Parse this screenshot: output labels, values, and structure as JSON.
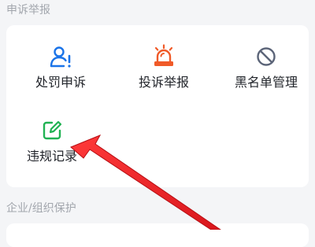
{
  "sections": [
    {
      "title": "申诉举报",
      "items": [
        {
          "label": "处罚申诉",
          "icon": "user-alert-icon",
          "color": "#1a73e8"
        },
        {
          "label": "投诉举报",
          "icon": "siren-icon",
          "color": "#f05a28"
        },
        {
          "label": "黑名单管理",
          "icon": "ban-icon",
          "color": "#5b6478"
        },
        {
          "label": "违规记录",
          "icon": "edit-note-icon",
          "color": "#21b253"
        }
      ]
    },
    {
      "title": "企业/组织保护",
      "items": []
    }
  ],
  "colors": {
    "background": "#f4f5f7",
    "card": "#ffffff",
    "section_title": "#a2a6ad",
    "arrow": "#e5262b"
  }
}
